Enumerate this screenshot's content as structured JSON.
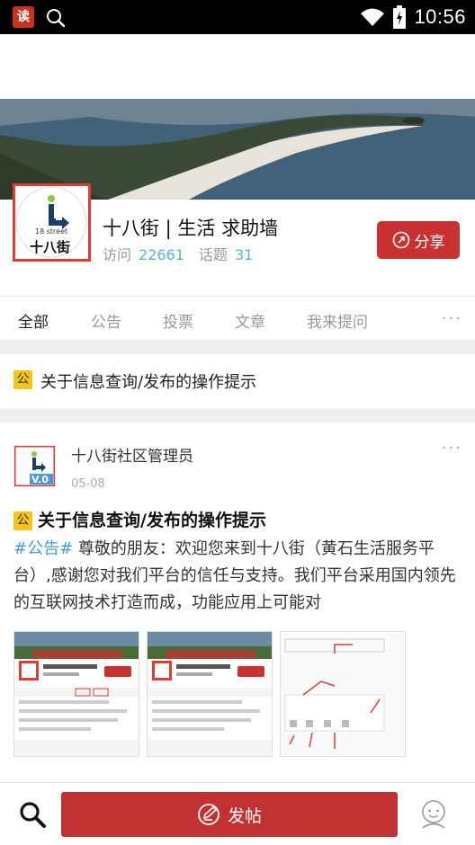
{
  "status_bar": {
    "app_badge_char": "读",
    "time": "10:56"
  },
  "community": {
    "title": "十八街 | 生活 求助墙",
    "visits_label": "访问",
    "visits_value": "22661",
    "topics_label": "话题",
    "topics_value": "31",
    "share_label": "分享",
    "logo_char": "十八街",
    "logo_small": "18 street"
  },
  "tabs": [
    {
      "label": "全部",
      "active": true
    },
    {
      "label": "公告",
      "active": false
    },
    {
      "label": "投票",
      "active": false
    },
    {
      "label": "文章",
      "active": false
    },
    {
      "label": "我来提问",
      "active": false
    }
  ],
  "notice": {
    "badge": "公",
    "text": "关于信息查询/发布的操作提示"
  },
  "post": {
    "author": "十八街社区管理员",
    "date": "05-08",
    "avatar_badge": "V.0",
    "title_badge": "公",
    "title": "关于信息查询/发布的操作提示",
    "hashtag": "#公告#",
    "body": " 尊敬的朋友：欢迎您来到十八街（黄石生活服务平台）,感谢您对我们平台的信任与支持。我们平台采用国内领先的互联网技术打造而成，功能应用上可能对"
  },
  "bottom_bar": {
    "post_label": "发帖"
  },
  "colors": {
    "accent": "#c83232",
    "link": "#5ab0de",
    "badge": "#f3c41a"
  }
}
